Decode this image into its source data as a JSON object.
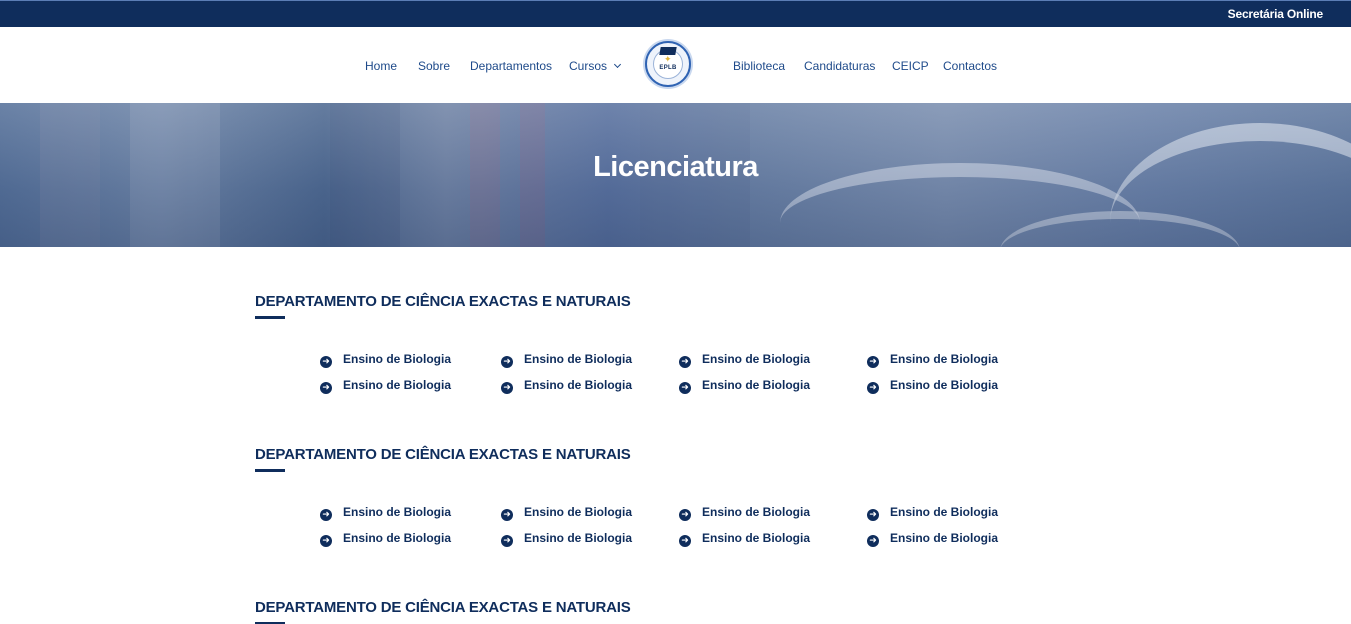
{
  "topbar": {
    "secretaria_label": "Secretária Online"
  },
  "nav": {
    "home": "Home",
    "sobre": "Sobre",
    "departamentos": "Departamentos",
    "cursos": "Cursos",
    "biblioteca": "Biblioteca",
    "candidaturas": "Candidaturas",
    "ceicp": "CEICP",
    "contactos": "Contactos",
    "logo_text": "EPLB"
  },
  "hero": {
    "title": "Licenciatura"
  },
  "sections": [
    {
      "title": "DEPARTAMENTO DE CIÊNCIA EXACTAS E NATURAIS",
      "courses": [
        "Ensino de Biologia",
        "Ensino de Biologia",
        "Ensino de Biologia",
        "Ensino de Biologia",
        "Ensino de Biologia",
        "Ensino de Biologia",
        "Ensino de Biologia",
        "Ensino de Biologia"
      ]
    },
    {
      "title": "DEPARTAMENTO DE CIÊNCIA EXACTAS E NATURAIS",
      "courses": [
        "Ensino de Biologia",
        "Ensino de Biologia",
        "Ensino de Biologia",
        "Ensino de Biologia",
        "Ensino de Biologia",
        "Ensino de Biologia",
        "Ensino de Biologia",
        "Ensino de Biologia"
      ]
    },
    {
      "title": "DEPARTAMENTO DE CIÊNCIA EXACTAS E NATURAIS",
      "courses": []
    }
  ],
  "icons": {
    "course_bullet": "arrow-circle-right-icon",
    "dropdown": "chevron-down-icon"
  },
  "colors": {
    "navy": "#0f2d5c",
    "link_blue": "#1e4a8a",
    "hero_overlay": "#5f789f"
  }
}
